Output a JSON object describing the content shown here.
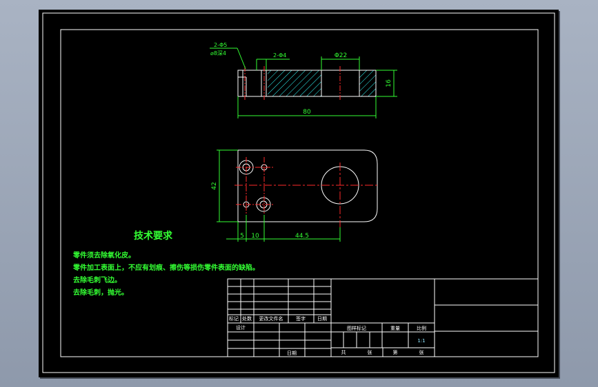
{
  "colors": {
    "background": "#9aa4b5",
    "sheet": "#000000",
    "outline": "#ffffff",
    "dimension": "#33ff33",
    "centerline": "#ff2a2a",
    "hatch": "#33ffff"
  },
  "drawing": {
    "top_view": {
      "callout_holes": "2-Φ5",
      "callout_counterbore": "⌀8深4",
      "callout_small_holes": "2-Φ4",
      "callout_bore": "Φ22",
      "dim_length": "80",
      "dim_thickness": "16"
    },
    "front_view": {
      "dim_height": "42",
      "dim_a": "5",
      "dim_b": "10",
      "dim_c": "44.5"
    }
  },
  "requirements": {
    "title": "技术要求",
    "lines": [
      "零件须去除氧化皮。",
      "零件加工表面上，不应有划痕、擦伤等损伤零件表面的缺陷。",
      "去除毛刺飞边。",
      "去除毛刺，抛光。"
    ]
  },
  "title_block": {
    "rev_headers": [
      "标记",
      "处数",
      "更改文件名",
      "签字",
      "日期"
    ],
    "designer": "设计",
    "date": "日期",
    "stage_label": "图样标记",
    "weight_label": "重量",
    "scale_label": "比例",
    "scale_value": "1:1",
    "total_label": "共",
    "sheet_label": "张",
    "page_label": "第",
    "page_sheet_label": "张"
  }
}
